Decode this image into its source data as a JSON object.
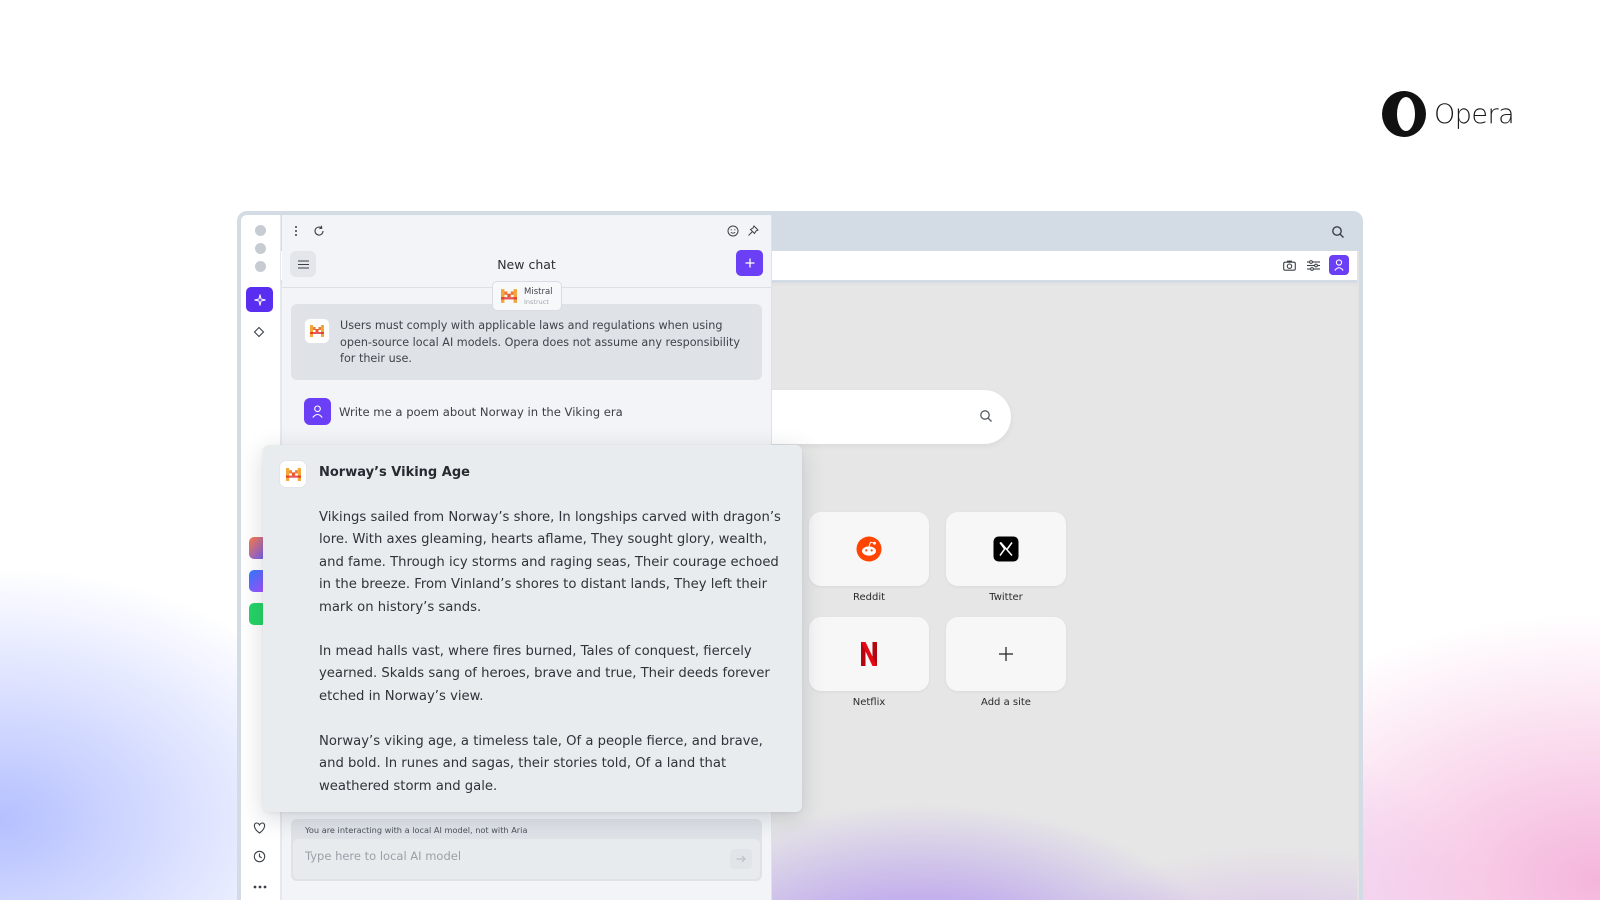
{
  "brand": {
    "wordmark": "Opera"
  },
  "chat": {
    "title": "New chat",
    "model": {
      "name": "Mistral",
      "variant": "Instruct"
    },
    "notice": "Users must comply with applicable laws and regulations when using open-source local AI models. Opera does not assume any responsibility for their use.",
    "user_message": "Write me a poem about Norway in the Viking era",
    "response": {
      "title": "Norway’s Viking Age",
      "stanzas": [
        "Vikings sailed from Norway’s shore, In longships carved with dragon’s lore. With axes gleaming, hearts aflame, They sought glory, wealth, and fame. Through icy storms and raging seas, Their courage echoed in the breeze. From Vinland’s shores to distant lands, They left their mark on history’s sands.",
        "In mead halls vast, where fires burned, Tales of conquest, fiercely yearned. Skalds sang of heroes, brave and true, Their deeds forever etched in Norway’s view.",
        "Norway’s viking age, a timeless tale, Of a people fierce, and brave, and bold. In runes and sagas, their stories told, Of a land that weathered storm and gale."
      ]
    },
    "input": {
      "info": "You are interacting with a local AI model, not with Aria",
      "placeholder": "Type here to local AI model"
    }
  },
  "speed_dial": {
    "tiles": [
      {
        "label": "Reddit",
        "icon": "reddit-icon"
      },
      {
        "label": "Twitter",
        "icon": "x-icon"
      },
      {
        "label": "Netflix",
        "icon": "netflix-icon"
      },
      {
        "label": "Add a site",
        "icon": "plus-icon"
      }
    ]
  },
  "colors": {
    "accent": "#6b3ff6",
    "aria": "#5a2ef0",
    "panel": "#f2f4f7",
    "reddit": "#ff4500",
    "netflix": "#e50914"
  }
}
